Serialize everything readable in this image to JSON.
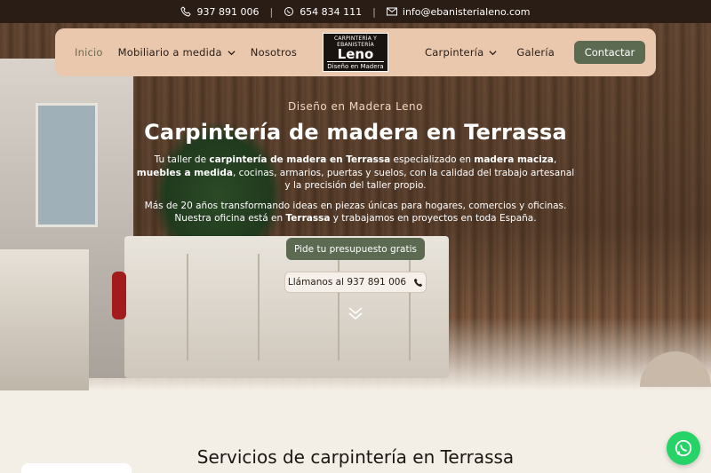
{
  "topbar": {
    "phone1": "937 891 006",
    "phone2": "654 834 111",
    "email": "info@ebanisterialeno.com"
  },
  "nav": {
    "left": [
      {
        "label": "Inicio"
      },
      {
        "label": "Mobiliario a medida"
      },
      {
        "label": "Nosotros"
      }
    ],
    "right": [
      {
        "label": "Carpintería"
      },
      {
        "label": "Galería"
      }
    ],
    "cta": "Contactar",
    "logo": {
      "line1": "CARPINTERÍA Y EBANISTERÍA",
      "line2": "Leno",
      "line3": "Diseño en Madera"
    }
  },
  "hero": {
    "eyebrow": "Diseño en Madera Leno",
    "title": "Carpintería de madera en Terrassa",
    "p1_parts": [
      "Tu taller de ",
      "carpintería de madera en Terrassa",
      " especializado en ",
      "madera maciza",
      ", ",
      "muebles a medida",
      ", cocinas, armarios, puertas y suelos, con la calidad del trabajo artesanal y la precisión del taller propio."
    ],
    "p2_parts": [
      "Más de 20 años transformando ideas en piezas únicas para hogares, comercios y oficinas. Nuestra oficina está en ",
      "Terrassa",
      " y trabajamos en proyectos en toda España."
    ],
    "cta1": "Pide tu presupuesto gratis",
    "cta2": "Llámanos al 937 891 006"
  },
  "services": {
    "title": "Servicios de carpintería en Terrassa"
  },
  "colors": {
    "accent": "#5c6a52",
    "nav_bg": "#e9c8ae",
    "topbar_bg": "#2a1d16",
    "whatsapp": "#25d366"
  }
}
